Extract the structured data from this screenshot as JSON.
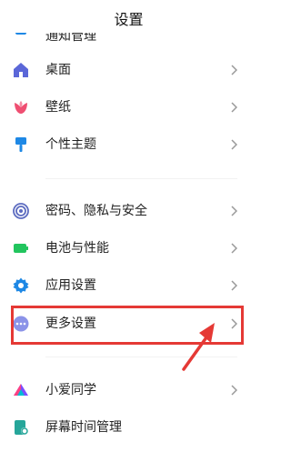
{
  "header": {
    "title": "设置"
  },
  "group1": {
    "partial_label": "通知管理",
    "items": [
      {
        "label": "桌面",
        "icon": "home-icon"
      },
      {
        "label": "壁纸",
        "icon": "tulip-icon"
      },
      {
        "label": "个性主题",
        "icon": "paintbrush-icon"
      }
    ]
  },
  "group2": {
    "items": [
      {
        "label": "密码、隐私与安全",
        "icon": "fingerprint-icon"
      },
      {
        "label": "电池与性能",
        "icon": "battery-icon"
      },
      {
        "label": "应用设置",
        "icon": "gear-icon"
      },
      {
        "label": "更多设置",
        "icon": "more-dots-icon"
      }
    ]
  },
  "group3": {
    "items": [
      {
        "label": "小爱同学",
        "icon": "assistant-icon"
      },
      {
        "label": "屏幕时间管理",
        "icon": "screen-time-icon"
      }
    ]
  },
  "colors": {
    "highlight": "#e53935",
    "home": "#5b67d8",
    "tulip": "#ef4f72",
    "brush": "#1e88e5",
    "fingerprint": "#5c6bc0",
    "battery": "#22c55e",
    "gear": "#1e88e5",
    "more": "#8b93e8"
  }
}
